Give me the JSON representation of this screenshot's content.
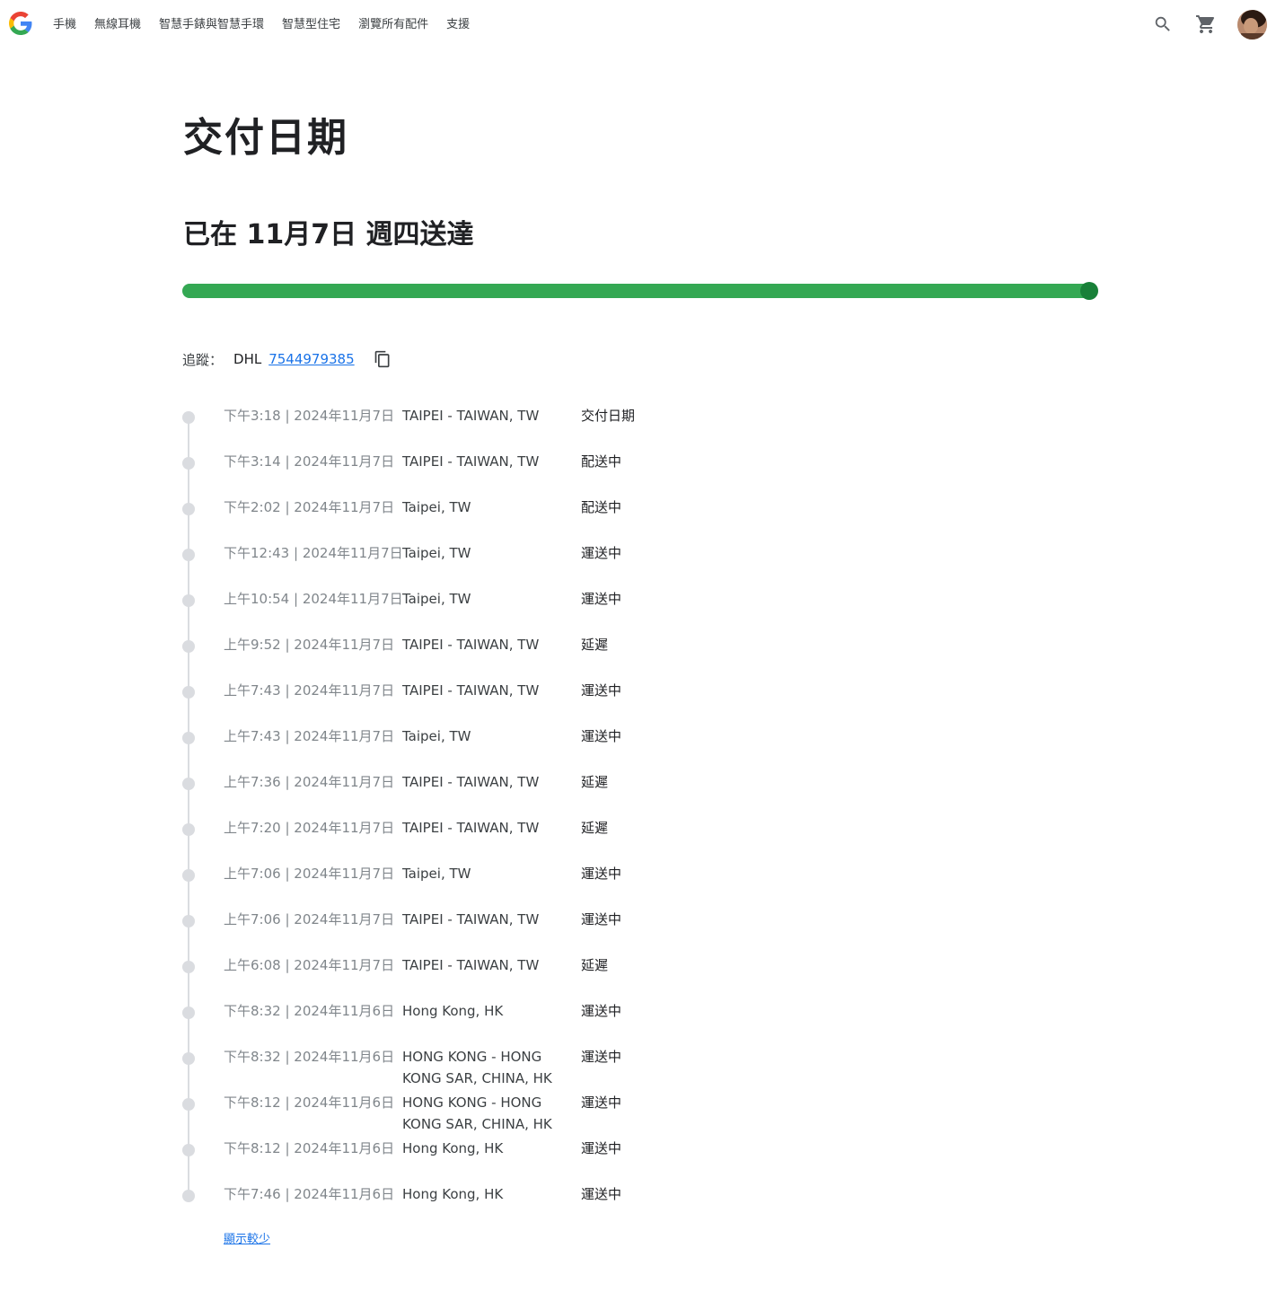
{
  "header": {
    "nav": [
      {
        "label": "手機"
      },
      {
        "label": "無線耳機"
      },
      {
        "label": "智慧手錶與智慧手環"
      },
      {
        "label": "智慧型住宅"
      },
      {
        "label": "瀏覽所有配件"
      },
      {
        "label": "支援"
      }
    ],
    "icons": {
      "logo": "google-g-logo",
      "search": "search-icon",
      "cart": "cart-icon",
      "avatar": "user-avatar"
    },
    "colors": {
      "blue": "#4285F4",
      "red": "#EA4335",
      "yellow": "#FBBC05",
      "green": "#34A853"
    }
  },
  "main": {
    "title": "交付日期",
    "status": "已在 11月7日 週四送達",
    "progress": {
      "fraction": 1.0,
      "fill_color": "#34a853",
      "knob_color": "#188038"
    },
    "tracking": {
      "label": "追蹤：",
      "carrier": "DHL",
      "number": "7544979385",
      "copy_icon": "copy-icon"
    },
    "events": [
      {
        "time": "下午3:18 | 2024年11月7日",
        "location": "TAIPEI - TAIWAN, TW",
        "status": "交付日期"
      },
      {
        "time": "下午3:14 | 2024年11月7日",
        "location": "TAIPEI - TAIWAN, TW",
        "status": "配送中"
      },
      {
        "time": "下午2:02 | 2024年11月7日",
        "location": "Taipei, TW",
        "status": "配送中"
      },
      {
        "time": "下午12:43 | 2024年11月7日",
        "location": "Taipei, TW",
        "status": "運送中"
      },
      {
        "time": "上午10:54 | 2024年11月7日",
        "location": "Taipei, TW",
        "status": "運送中"
      },
      {
        "time": "上午9:52 | 2024年11月7日",
        "location": "TAIPEI - TAIWAN, TW",
        "status": "延遲"
      },
      {
        "time": "上午7:43 | 2024年11月7日",
        "location": "TAIPEI - TAIWAN, TW",
        "status": "運送中"
      },
      {
        "time": "上午7:43 | 2024年11月7日",
        "location": "Taipei, TW",
        "status": "運送中"
      },
      {
        "time": "上午7:36 | 2024年11月7日",
        "location": "TAIPEI - TAIWAN, TW",
        "status": "延遲"
      },
      {
        "time": "上午7:20 | 2024年11月7日",
        "location": "TAIPEI - TAIWAN, TW",
        "status": "延遲"
      },
      {
        "time": "上午7:06 | 2024年11月7日",
        "location": "Taipei, TW",
        "status": "運送中"
      },
      {
        "time": "上午7:06 | 2024年11月7日",
        "location": "TAIPEI - TAIWAN, TW",
        "status": "運送中"
      },
      {
        "time": "上午6:08 | 2024年11月7日",
        "location": "TAIPEI - TAIWAN, TW",
        "status": "延遲"
      },
      {
        "time": "下午8:32 | 2024年11月6日",
        "location": "Hong Kong, HK",
        "status": "運送中"
      },
      {
        "time": "下午8:32 | 2024年11月6日",
        "location": "HONG KONG - HONG KONG SAR, CHINA, HK",
        "status": "運送中"
      },
      {
        "time": "下午8:12 | 2024年11月6日",
        "location": "HONG KONG - HONG KONG SAR, CHINA, HK",
        "status": "運送中"
      },
      {
        "time": "下午8:12 | 2024年11月6日",
        "location": "Hong Kong, HK",
        "status": "運送中"
      },
      {
        "time": "下午7:46 | 2024年11月6日",
        "location": "Hong Kong, HK",
        "status": "運送中"
      }
    ],
    "show_less": "顯示較少"
  }
}
